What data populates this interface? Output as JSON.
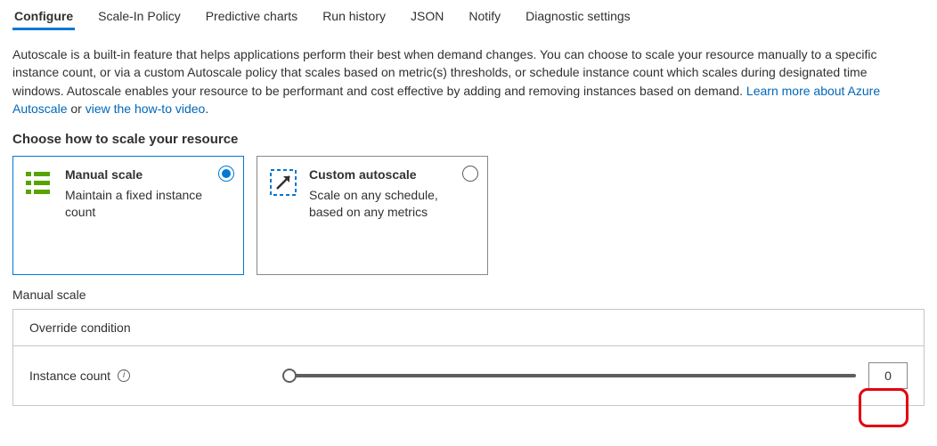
{
  "tabs": {
    "configure": "Configure",
    "scaleIn": "Scale-In Policy",
    "predictive": "Predictive charts",
    "runHistory": "Run history",
    "json": "JSON",
    "notify": "Notify",
    "diagnostic": "Diagnostic settings"
  },
  "intro": {
    "text1": "Autoscale is a built-in feature that helps applications perform their best when demand changes. You can choose to scale your resource manually to a specific instance count, or via a custom Autoscale policy that scales based on metric(s) thresholds, or schedule instance count which scales during designated time windows. Autoscale enables your resource to be performant and cost effective by adding and removing instances based on demand. ",
    "link1": "Learn more about Azure Autoscale",
    "middle": " or ",
    "link2": "view the how-to video",
    "tail": "."
  },
  "chooseTitle": "Choose how to scale your resource",
  "cards": {
    "manual": {
      "title": "Manual scale",
      "desc": "Maintain a fixed instance count"
    },
    "custom": {
      "title": "Custom autoscale",
      "desc": "Scale on any schedule, based on any metrics"
    }
  },
  "manualScale": {
    "heading": "Manual scale",
    "override": "Override condition",
    "instanceCountLabel": "Instance count",
    "instanceCountValue": "0"
  }
}
